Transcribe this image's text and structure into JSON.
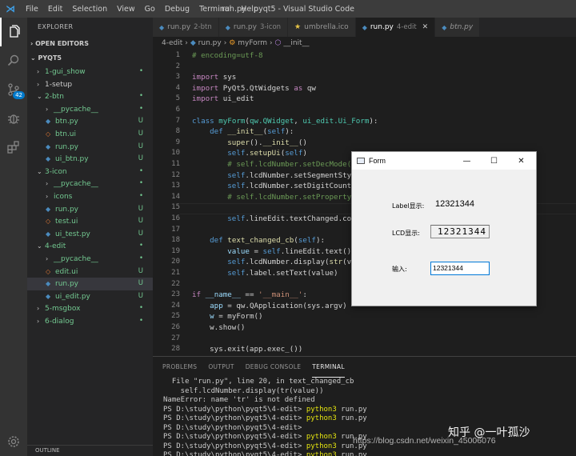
{
  "window": {
    "title": "run.py - pyqt5 - Visual Studio Code",
    "menu": [
      "File",
      "Edit",
      "Selection",
      "View",
      "Go",
      "Debug",
      "Terminal",
      "Help"
    ]
  },
  "activity": {
    "scm_badge": "42"
  },
  "sidebar": {
    "header": "EXPLORER",
    "open_editors": "OPEN EDITORS",
    "project": "PYQT5",
    "footer": "OUTLINE",
    "items": [
      {
        "label": "1-gui_show",
        "indent": 1,
        "kind": "folder",
        "open": false,
        "status": "•",
        "color": "green"
      },
      {
        "label": "1-setup",
        "indent": 1,
        "kind": "folder",
        "open": false,
        "status": ""
      },
      {
        "label": "2-btn",
        "indent": 1,
        "kind": "folder",
        "open": true,
        "status": "•",
        "color": "green"
      },
      {
        "label": "__pycache__",
        "indent": 2,
        "kind": "folder",
        "open": false,
        "status": "•",
        "color": "green"
      },
      {
        "label": "btn.py",
        "indent": 2,
        "kind": "py",
        "status": "U",
        "color": "green"
      },
      {
        "label": "btn.ui",
        "indent": 2,
        "kind": "ui",
        "status": "U",
        "color": "green"
      },
      {
        "label": "run.py",
        "indent": 2,
        "kind": "py",
        "status": "U",
        "color": "green"
      },
      {
        "label": "ui_btn.py",
        "indent": 2,
        "kind": "py",
        "status": "U",
        "color": "green"
      },
      {
        "label": "3-icon",
        "indent": 1,
        "kind": "folder",
        "open": true,
        "status": "•",
        "color": "green"
      },
      {
        "label": "__pycache__",
        "indent": 2,
        "kind": "folder",
        "open": false,
        "status": "•",
        "color": "green"
      },
      {
        "label": "icons",
        "indent": 2,
        "kind": "folder",
        "open": false,
        "status": "•",
        "color": "green"
      },
      {
        "label": "run.py",
        "indent": 2,
        "kind": "py",
        "status": "U",
        "color": "green"
      },
      {
        "label": "test.ui",
        "indent": 2,
        "kind": "ui",
        "status": "U",
        "color": "green"
      },
      {
        "label": "ui_test.py",
        "indent": 2,
        "kind": "py",
        "status": "U",
        "color": "green"
      },
      {
        "label": "4-edit",
        "indent": 1,
        "kind": "folder",
        "open": true,
        "status": "•",
        "color": "green"
      },
      {
        "label": "__pycache__",
        "indent": 2,
        "kind": "folder",
        "open": false,
        "status": "•",
        "color": "green"
      },
      {
        "label": "edit.ui",
        "indent": 2,
        "kind": "ui",
        "status": "U",
        "color": "green"
      },
      {
        "label": "run.py",
        "indent": 2,
        "kind": "py",
        "status": "U",
        "color": "green",
        "selected": true
      },
      {
        "label": "ui_edit.py",
        "indent": 2,
        "kind": "py",
        "status": "U",
        "color": "green"
      },
      {
        "label": "5-msgbox",
        "indent": 1,
        "kind": "folder",
        "open": false,
        "status": "•",
        "color": "green"
      },
      {
        "label": "6-dialog",
        "indent": 1,
        "kind": "folder",
        "open": false,
        "status": "•",
        "color": "green"
      }
    ]
  },
  "tabs": [
    {
      "label": "run.py",
      "sub": "2-btn",
      "icon": "py"
    },
    {
      "label": "run.py",
      "sub": "3-icon",
      "icon": "py"
    },
    {
      "label": "umbrella.ico",
      "sub": "",
      "icon": "star"
    },
    {
      "label": "run.py",
      "sub": "4-edit",
      "icon": "py",
      "active": true
    },
    {
      "label": "btn.py",
      "sub": "",
      "icon": "py",
      "italic": true
    }
  ],
  "breadcrumb": {
    "folder": "4-edit",
    "file": "run.py",
    "cls": "myForm",
    "fn": "__init__"
  },
  "editor": {
    "lines": [
      {
        "n": "1",
        "code": [
          [
            "cm",
            "# encoding=utf-8"
          ]
        ]
      },
      {
        "n": "2",
        "code": []
      },
      {
        "n": "3",
        "code": [
          [
            "kw",
            "import"
          ],
          [
            "",
            " sys"
          ]
        ]
      },
      {
        "n": "4",
        "code": [
          [
            "kw",
            "import"
          ],
          [
            "",
            " PyQt5.QtWidgets "
          ],
          [
            "kw",
            "as"
          ],
          [
            "",
            " qw"
          ]
        ]
      },
      {
        "n": "5",
        "code": [
          [
            "kw",
            "import"
          ],
          [
            "",
            " ui_edit"
          ]
        ]
      },
      {
        "n": "6",
        "code": []
      },
      {
        "n": "7",
        "code": [
          [
            "kw2",
            "class"
          ],
          [
            "",
            " "
          ],
          [
            "clsn",
            "myForm"
          ],
          [
            "",
            "("
          ],
          [
            "clsn",
            "qw.QWidget"
          ],
          [
            "",
            ", "
          ],
          [
            "clsn",
            "ui_edit.Ui_Form"
          ],
          [
            "",
            "):"
          ]
        ]
      },
      {
        "n": "8",
        "code": [
          [
            "",
            "    "
          ],
          [
            "kw2",
            "def"
          ],
          [
            "",
            " "
          ],
          [
            "fnc",
            "__init__"
          ],
          [
            "",
            "("
          ],
          [
            "slf",
            "self"
          ],
          [
            "",
            "):"
          ]
        ]
      },
      {
        "n": "9",
        "code": [
          [
            "",
            "        "
          ],
          [
            "fnc",
            "super"
          ],
          [
            "",
            "()."
          ],
          [
            "fnc",
            "__init__"
          ],
          [
            "",
            "()"
          ]
        ]
      },
      {
        "n": "10",
        "code": [
          [
            "",
            "        "
          ],
          [
            "slf",
            "self"
          ],
          [
            "",
            "."
          ],
          [
            "fnc",
            "setupUi"
          ],
          [
            "",
            "("
          ],
          [
            "slf",
            "self"
          ],
          [
            "",
            ")"
          ]
        ]
      },
      {
        "n": "11",
        "code": [
          [
            "",
            "        "
          ],
          [
            "cm",
            "# self.lcdNumber.setDecMode("
          ]
        ]
      },
      {
        "n": "12",
        "code": [
          [
            "",
            "        "
          ],
          [
            "slf",
            "self"
          ],
          [
            "",
            ".lcdNumber.setSegmentSty"
          ]
        ]
      },
      {
        "n": "13",
        "code": [
          [
            "",
            "        "
          ],
          [
            "slf",
            "self"
          ],
          [
            "",
            ".lcdNumber.setDigitCount"
          ]
        ]
      },
      {
        "n": "14",
        "code": [
          [
            "",
            "        "
          ],
          [
            "cm",
            "# self.lcdNumber.setProperty"
          ]
        ]
      },
      {
        "n": "15",
        "code": [],
        "current": true
      },
      {
        "n": "16",
        "code": [
          [
            "",
            "        "
          ],
          [
            "slf",
            "self"
          ],
          [
            "",
            ".lineEdit.textChanged.co"
          ]
        ]
      },
      {
        "n": "17",
        "code": []
      },
      {
        "n": "18",
        "code": [
          [
            "",
            "    "
          ],
          [
            "kw2",
            "def"
          ],
          [
            "",
            " "
          ],
          [
            "fnc",
            "text_changed_cb"
          ],
          [
            "",
            "("
          ],
          [
            "slf",
            "self"
          ],
          [
            "",
            "):"
          ]
        ]
      },
      {
        "n": "19",
        "code": [
          [
            "",
            "        "
          ],
          [
            "var",
            "value"
          ],
          [
            "",
            " = "
          ],
          [
            "slf",
            "self"
          ],
          [
            "",
            ".lineEdit.text()"
          ]
        ]
      },
      {
        "n": "20",
        "code": [
          [
            "",
            "        "
          ],
          [
            "slf",
            "self"
          ],
          [
            "",
            ".lcdNumber.display("
          ],
          [
            "fnc",
            "str"
          ],
          [
            "",
            "(v"
          ]
        ]
      },
      {
        "n": "21",
        "code": [
          [
            "",
            "        "
          ],
          [
            "slf",
            "self"
          ],
          [
            "",
            ".label.setText(value)"
          ]
        ]
      },
      {
        "n": "22",
        "code": []
      },
      {
        "n": "23",
        "code": [
          [
            "kw",
            "if"
          ],
          [
            "",
            " "
          ],
          [
            "var",
            "__name__"
          ],
          [
            "",
            " == "
          ],
          [
            "st",
            "'__main__'"
          ],
          [
            "",
            ":"
          ]
        ]
      },
      {
        "n": "24",
        "code": [
          [
            "",
            "    "
          ],
          [
            "var",
            "app"
          ],
          [
            "",
            " = qw.QApplication(sys.argv)"
          ]
        ]
      },
      {
        "n": "25",
        "code": [
          [
            "",
            "    "
          ],
          [
            "var",
            "w"
          ],
          [
            "",
            " = myForm()"
          ]
        ]
      },
      {
        "n": "26",
        "code": [
          [
            "",
            "    "
          ],
          [
            "",
            "w.show()"
          ]
        ]
      },
      {
        "n": "27",
        "code": []
      },
      {
        "n": "28",
        "code": [
          [
            "",
            "    "
          ],
          [
            "",
            "sys.exit(app.exec_())"
          ]
        ]
      }
    ]
  },
  "panel": {
    "tabs": [
      "PROBLEMS",
      "OUTPUT",
      "DEBUG CONSOLE",
      "TERMINAL"
    ],
    "active_tab": "TERMINAL",
    "terminal": [
      [
        [
          "",
          "  File \"run.py\", line 20, in text_changed_cb"
        ]
      ],
      [
        [
          "",
          "    self.lcdNumber.display(tr(value))"
        ]
      ],
      [
        [
          "",
          "NameError: name 'tr' is not defined"
        ]
      ],
      [
        [
          "",
          "PS D:\\study\\python\\pyqt5\\4-edit> "
        ],
        [
          "cmd",
          "python3"
        ],
        [
          "",
          " run.py"
        ]
      ],
      [
        [
          "",
          "PS D:\\study\\python\\pyqt5\\4-edit> "
        ],
        [
          "cmd",
          "python3"
        ],
        [
          "",
          " run.py"
        ]
      ],
      [
        [
          "",
          "PS D:\\study\\python\\pyqt5\\4-edit>"
        ]
      ],
      [
        [
          "",
          "PS D:\\study\\python\\pyqt5\\4-edit> "
        ],
        [
          "cmd",
          "python3"
        ],
        [
          "",
          " run.py"
        ]
      ],
      [
        [
          "",
          "PS D:\\study\\python\\pyqt5\\4-edit> "
        ],
        [
          "cmd",
          "python3"
        ],
        [
          "",
          " run.py"
        ]
      ],
      [
        [
          "",
          "PS D:\\study\\python\\pyqt5\\4-edit> "
        ],
        [
          "cmd",
          "python3"
        ],
        [
          "",
          " run.py"
        ]
      ]
    ]
  },
  "form": {
    "title": "Form",
    "minimize": "—",
    "maximize": "☐",
    "close": "✕",
    "label_caption": "Label显示:",
    "label_value": "12321344",
    "lcd_caption": "LCD显示:",
    "lcd_value": "12321344",
    "input_caption": "输入:",
    "input_value": "12321344"
  },
  "watermark": {
    "text": "知乎 @一叶孤沙",
    "url": "https://blog.csdn.net/weixin_45006076"
  }
}
